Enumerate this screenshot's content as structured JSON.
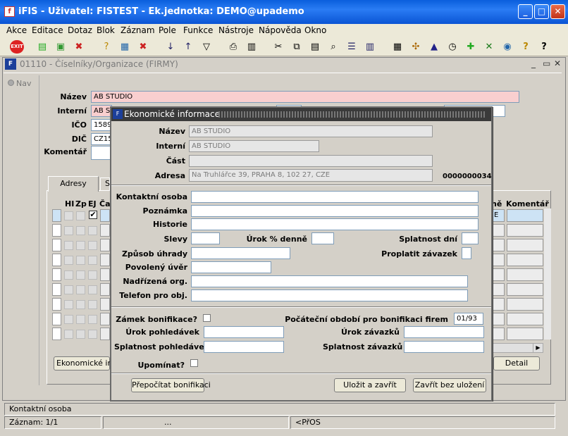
{
  "window": {
    "app_icon": "iFIS-icon",
    "title": "iFIS - Uživatel: FISTEST - Ek.jednotka: DEMO@upademo"
  },
  "menu": [
    "Akce",
    "Editace",
    "Dotaz",
    "Blok",
    "Záznam",
    "Pole",
    "Funkce",
    "Nástroje",
    "Nápověda",
    "Okno"
  ],
  "child": {
    "title": "01110 - Číselníky/Organizace (FIRMY)",
    "nav": "Nav"
  },
  "form": {
    "nazev_label": "Název",
    "nazev": "AB STUDIO",
    "interni_label": "Interní",
    "interni": "AB S",
    "ico_label": "IČO",
    "ico": "1589",
    "dic_label": "DIČ",
    "dic": "CZ15",
    "komentar_label": "Komentář"
  },
  "tabs": {
    "adresy": "Adresy",
    "second": "S"
  },
  "grid": {
    "headers": [
      "HI",
      "Zp",
      "EJ",
      "Ča"
    ],
    "right_headers": [
      "ně",
      "Komentář"
    ],
    "right_first": "E"
  },
  "buttons": {
    "ekonomicke": "Ekonomické inf...",
    "detail": "Detail"
  },
  "dialog": {
    "title": "Ekonomické informace",
    "nazev_label": "Název",
    "nazev": "AB STUDIO",
    "interni_label": "Interní",
    "interni": "AB STUDIO",
    "cast_label": "Část",
    "adresa_label": "Adresa",
    "adresa": "Na Truhlářce 39, PRAHA 8, 102 27, CZE",
    "adresa_id": "0000000034",
    "kontaktni_label": "Kontaktní osoba",
    "poznamka_label": "Poznámka",
    "historie_label": "Historie",
    "slevy_label": "Slevy",
    "urok_denne_label": "Úrok % denně",
    "splatnost_dni_label": "Splatnost dní",
    "zpusob_label": "Způsob úhrady",
    "proplatit_label": "Proplatit závazek",
    "povoleny_label": "Povolený úvěr",
    "nadrizena_label": "Nadřízená org.",
    "telefon_label": "Telefon pro obj.",
    "zamek_label": "Zámek bonifikace?",
    "pocatecni_label": "Počáteční období pro bonifikaci firem",
    "pocatecni": "01/93",
    "urok_pohl_label": "Úrok pohledávek",
    "urok_zav_label": "Úrok závazků",
    "splat_pohl_label": "Splatnost pohledávek",
    "splat_zav_label": "Splatnost závazků",
    "upominat_label": "Upomínat?",
    "btn_prepocitat": "Přepočítat bonifikaci",
    "btn_ulozit": "Uložit a zavřít",
    "btn_zavrit": "Zavřít bez uložení"
  },
  "status": {
    "field": "Kontaktní osoba",
    "record": "Záznam: 1/1",
    "dots": "...",
    "osc": "<PřOS"
  },
  "colors": {
    "title_blue": "#0a5fdc",
    "required_pink": "#f9cfcf",
    "dialog_title": "#3a3a3a"
  }
}
